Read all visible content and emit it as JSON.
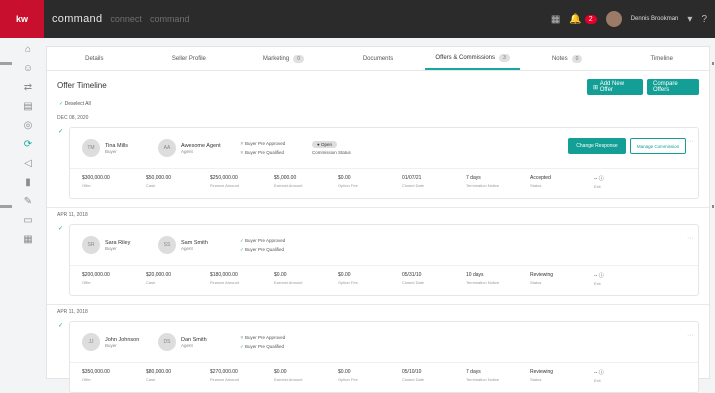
{
  "topbar": {
    "logo": "kw",
    "brand": "command",
    "brand_faded_1": "connect",
    "brand_faded_2": "command",
    "notification_count": "2",
    "user_name": "Dennis Brookman"
  },
  "sidebar": {
    "icons": [
      "home-icon",
      "contacts-icon",
      "deals-icon",
      "calendar-icon",
      "location-icon",
      "opportunities-icon",
      "marketing-icon",
      "reports-icon",
      "tasks-icon",
      "documents-icon",
      "calculator-icon"
    ],
    "active_index": 5
  },
  "tabs": [
    {
      "label": "Details",
      "count": ""
    },
    {
      "label": "Seller Profile",
      "count": ""
    },
    {
      "label": "Marketing",
      "count": "0"
    },
    {
      "label": "Documents",
      "count": ""
    },
    {
      "label": "Offers & Commissions",
      "count": "3"
    },
    {
      "label": "Notes",
      "count": "0"
    },
    {
      "label": "Timeline",
      "count": ""
    }
  ],
  "page_title": "Offer Timeline",
  "add_offer_label": "Add New Offer",
  "compare_label": "Compare Offers",
  "deselect_label": "Deselect All",
  "offers": [
    {
      "date": "DEC 08, 2020",
      "buyer": {
        "initials": "TM",
        "name": "Tina Mills",
        "role": "Buyer"
      },
      "agent": {
        "initials": "AA",
        "name": "Awesome Agent",
        "role": "Agent"
      },
      "preapproved": "Buyer Pre Approved",
      "prequalified": "Buyer Pre Qualified",
      "commission_state": "Open",
      "commission_label": "Commission Status",
      "change_response": "Change Response",
      "manage_commission": "Manage Commission",
      "stats": [
        {
          "value": "$300,000.00",
          "label": "Offer"
        },
        {
          "value": "$50,000.00",
          "label": "Cash"
        },
        {
          "value": "$250,000.00",
          "label": "Finance Amount"
        },
        {
          "value": "$5,000.00",
          "label": "Earnest Amount"
        },
        {
          "value": "$0.00",
          "label": "Option Fee"
        },
        {
          "value": "01/07/21",
          "label": "Closed Date"
        },
        {
          "value": "7 days",
          "label": "Termination Notice"
        },
        {
          "value": "Accepted",
          "label": "Status"
        },
        {
          "value": "--",
          "label": "Exit"
        }
      ]
    },
    {
      "date": "APR 11, 2018",
      "buyer": {
        "initials": "SR",
        "name": "Sara Riley",
        "role": "Buyer"
      },
      "agent": {
        "initials": "SS",
        "name": "Sam Smith",
        "role": "Agent"
      },
      "preapproved": "Buyer Pre Approved",
      "prequalified": "Buyer Pre Qualified",
      "stats": [
        {
          "value": "$200,000.00",
          "label": "Offer"
        },
        {
          "value": "$20,000.00",
          "label": "Cash"
        },
        {
          "value": "$180,000.00",
          "label": "Finance Amount"
        },
        {
          "value": "$0.00",
          "label": "Earnest Amount"
        },
        {
          "value": "$0.00",
          "label": "Option Fee"
        },
        {
          "value": "05/31/10",
          "label": "Closed Date"
        },
        {
          "value": "10 days",
          "label": "Termination Notice"
        },
        {
          "value": "Reviewing",
          "label": "Status"
        },
        {
          "value": "--",
          "label": "Exit"
        }
      ]
    },
    {
      "date": "APR 11, 2018",
      "buyer": {
        "initials": "JJ",
        "name": "John Johnson",
        "role": "Buyer"
      },
      "agent": {
        "initials": "DS",
        "name": "Dan Smith",
        "role": "Agent"
      },
      "preapproved": "Buyer Pre Approved",
      "prequalified": "Buyer Pre Qualified",
      "stats": [
        {
          "value": "$350,000.00",
          "label": "Offer"
        },
        {
          "value": "$80,000.00",
          "label": "Cash"
        },
        {
          "value": "$270,000.00",
          "label": "Finance Amount"
        },
        {
          "value": "$0.00",
          "label": "Earnest Amount"
        },
        {
          "value": "$0.00",
          "label": "Option Fee"
        },
        {
          "value": "05/10/10",
          "label": "Closed Date"
        },
        {
          "value": "7 days",
          "label": "Termination Notice"
        },
        {
          "value": "Reviewing",
          "label": "Status"
        },
        {
          "value": "--",
          "label": "Exit"
        }
      ]
    }
  ],
  "colors": {
    "accent": "#149f96",
    "brand": "#c8102e",
    "topbar": "#2b2b2b"
  }
}
